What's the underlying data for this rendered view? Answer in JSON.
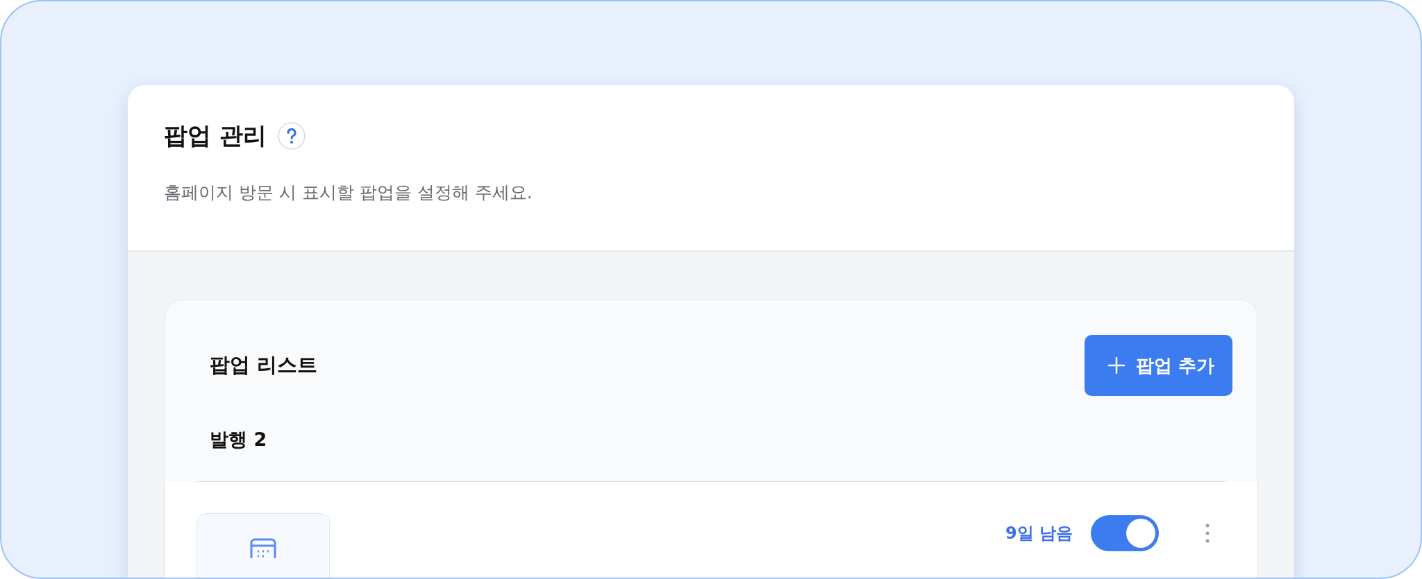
{
  "header": {
    "title": "팝업 관리",
    "subtitle": "홈페이지 방문 시 표시할 팝업을 설정해 주세요."
  },
  "list": {
    "title": "팝업 리스트",
    "add_button": "팝업 추가",
    "section": "발행 2",
    "items": [
      {
        "remaining": "9일 남음",
        "on": true
      }
    ]
  }
}
